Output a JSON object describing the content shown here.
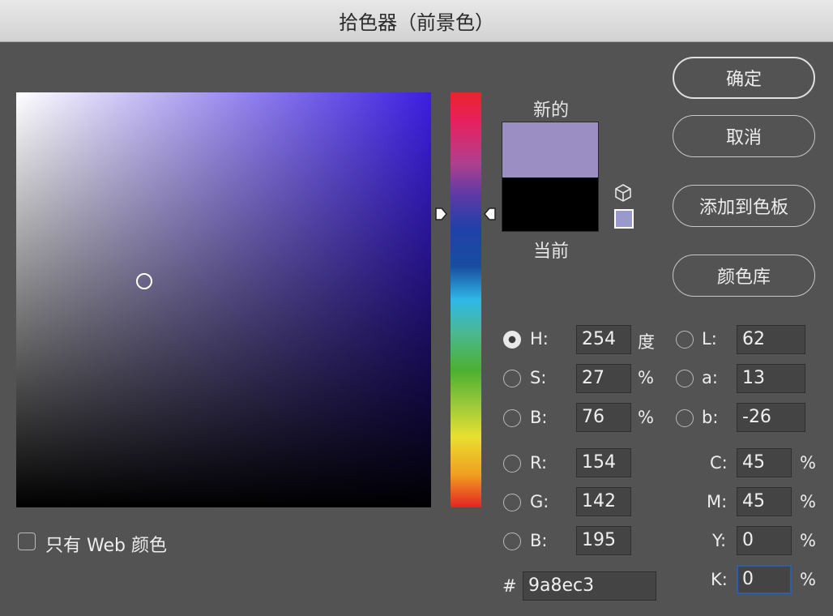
{
  "window": {
    "title": "拾色器（前景色）"
  },
  "preview": {
    "new_label": "新的",
    "current_label": "当前",
    "new_color": "#9a8ec3",
    "current_color": "#000000"
  },
  "buttons": {
    "ok": "确定",
    "cancel": "取消",
    "add_to_swatches": "添加到色板",
    "color_libraries": "颜色库"
  },
  "hsb": {
    "h": {
      "label": "H:",
      "value": "254",
      "unit": "度"
    },
    "s": {
      "label": "S:",
      "value": "27",
      "unit": "%"
    },
    "b": {
      "label": "B:",
      "value": "76",
      "unit": "%"
    }
  },
  "rgb": {
    "r": {
      "label": "R:",
      "value": "154"
    },
    "g": {
      "label": "G:",
      "value": "142"
    },
    "b": {
      "label": "B:",
      "value": "195"
    }
  },
  "lab": {
    "l": {
      "label": "L:",
      "value": "62"
    },
    "a": {
      "label": "a:",
      "value": "13"
    },
    "b": {
      "label": "b:",
      "value": "-26"
    }
  },
  "cmyk": {
    "c": {
      "label": "C:",
      "value": "45",
      "unit": "%"
    },
    "m": {
      "label": "M:",
      "value": "45",
      "unit": "%"
    },
    "y": {
      "label": "Y:",
      "value": "0",
      "unit": "%"
    },
    "k": {
      "label": "K:",
      "value": "0",
      "unit": "%"
    }
  },
  "hex": {
    "label": "#",
    "value": "9a8ec3"
  },
  "web_only": {
    "label": "只有 Web 颜色",
    "checked": false
  },
  "selected_channel": "H",
  "icons": {
    "gamut_warning": "cube-icon",
    "web_safe": "web-safe-swatch-icon"
  }
}
